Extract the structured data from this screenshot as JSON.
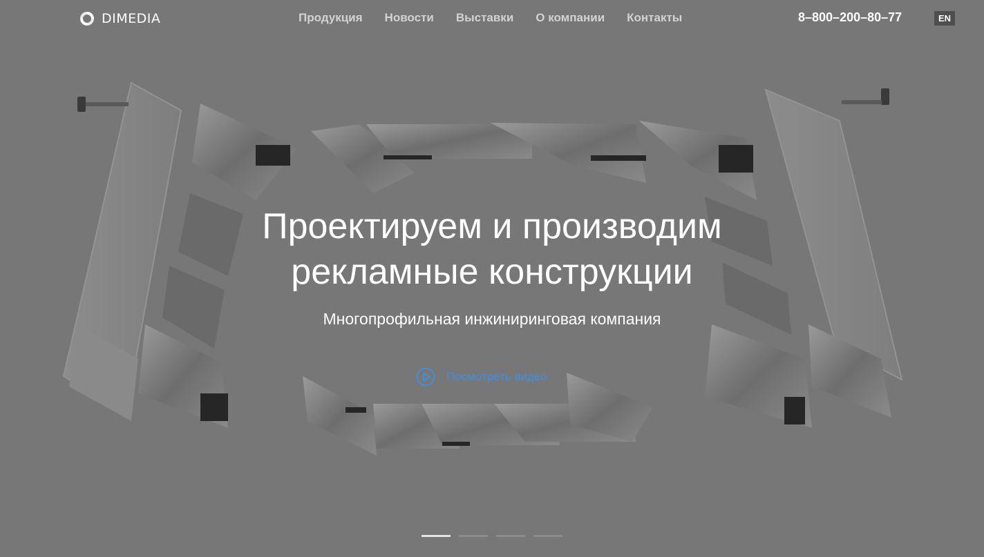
{
  "header": {
    "logo_text": "DIMEDIA",
    "nav": [
      {
        "label": "Продукция"
      },
      {
        "label": "Новости"
      },
      {
        "label": "Выставки"
      },
      {
        "label": "О компании"
      },
      {
        "label": "Контакты"
      }
    ],
    "phone": "8–800–200–80–77",
    "lang": "EN"
  },
  "hero": {
    "title_line1": "Проектируем и производим",
    "title_line2": "рекламные конструкции",
    "subtitle": "Многопрофильная инжиниринговая компания",
    "video_label": "Посмотреть видео",
    "slides_count": 4,
    "active_slide": 1
  },
  "colors": {
    "background": "#777777",
    "accent": "#3f8fe0"
  }
}
